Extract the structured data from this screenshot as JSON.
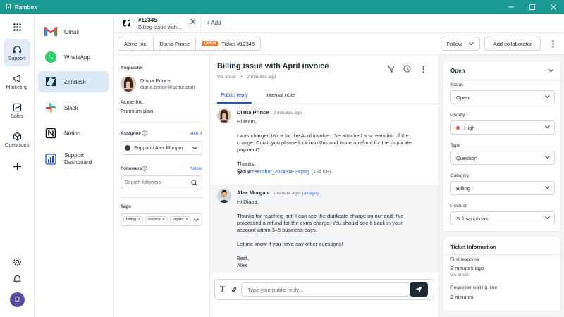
{
  "app": {
    "title": "Rambox"
  },
  "rail": {
    "items": [
      {
        "label": "Support",
        "icon": "headset-icon"
      },
      {
        "label": "Marketing",
        "icon": "megaphone-icon"
      },
      {
        "label": "Sales",
        "icon": "chart-icon"
      },
      {
        "label": "Operations",
        "icon": "cube-icon"
      }
    ]
  },
  "apps": [
    {
      "label": "Gmail",
      "icon": "gmail-icon"
    },
    {
      "label": "WhatsApp",
      "icon": "whatsapp-icon"
    },
    {
      "label": "Zendesk",
      "icon": "zendesk-icon"
    },
    {
      "label": "Slack",
      "icon": "slack-icon"
    },
    {
      "label": "Notion",
      "icon": "notion-icon"
    },
    {
      "label": "Support Dashboard",
      "icon": "dashboard-icon"
    }
  ],
  "tab": {
    "ticket_id": "#12345",
    "subtitle": "Billing issue with...",
    "add_label": "Add"
  },
  "breadcrumb": {
    "org": "Acme Inc.",
    "person": "Diana Prince",
    "badge": "OPEN",
    "ticket": "Ticket #12345"
  },
  "actions": {
    "follow": "Follow",
    "add_collaborator": "Add collaborator"
  },
  "requester": {
    "heading": "Requester",
    "name": "Diana Prince",
    "email": "diana.prince@acme.com",
    "org": "Acme Inc.",
    "plan": "Premium plan",
    "assignee_label": "Assignee",
    "take_it": "take it",
    "assignee_value": "Support / Alex Morgan",
    "followers_label": "Followers",
    "follow_link": "follow",
    "followers_placeholder": "Search followers",
    "tags_label": "Tags",
    "tags": [
      "billing",
      "invoice",
      "urgent"
    ]
  },
  "conversation": {
    "title": "Billing issue with April invoice",
    "via": "Via email",
    "time": "2 minutes ago",
    "tab_public": "Public reply",
    "tab_internal": "Internal note",
    "messages": [
      {
        "author": "Diana Prince",
        "time": "2 minutes ago",
        "assign": "",
        "body": "Hi team,\n\nI was charged twice for the April invoice. I've attached a screenshot of the\ncharge. Could you please look into this and issue a refund for the duplicate\npayment?\n\nThanks,\nDiana",
        "attachment": "Screenshot_2024-04-28.png",
        "attachment_size": "(134 KB)"
      },
      {
        "author": "Alex Morgan",
        "time": "1 minute ago",
        "assign": "(assign)",
        "body": "Hi Diana,\n\nThanks for reaching out! I can see the duplicate charge on our end. I've\nprocessed a refund for the extra charge. You should see it back in your\naccount within 3–5 business days.\n\nLet me know if you have any other questions!\n\nBest,\nAlex"
      }
    ],
    "composer_placeholder": "Type your public reply..."
  },
  "properties": {
    "status_title": "Open",
    "fields": [
      {
        "label": "Status",
        "value": "Open"
      },
      {
        "label": "Priority",
        "value": "High",
        "dot_color": "#e5484d"
      },
      {
        "label": "Type",
        "value": "Question"
      },
      {
        "label": "Category",
        "value": "Billing"
      },
      {
        "label": "Product",
        "value": "Subscriptions"
      }
    ],
    "ticket_info_title": "Ticket Information",
    "first_response_label": "First response",
    "first_response_value": "2 minutes ago",
    "first_response_via": "via email",
    "waiting_label": "Requester waiting time",
    "waiting_value": "2 minutes"
  },
  "user": {
    "initial": "D"
  },
  "colors": {
    "brand": "#1c9a95",
    "accent": "#1d4ed8",
    "badge": "#f07c3c",
    "send": "#1f2933"
  }
}
